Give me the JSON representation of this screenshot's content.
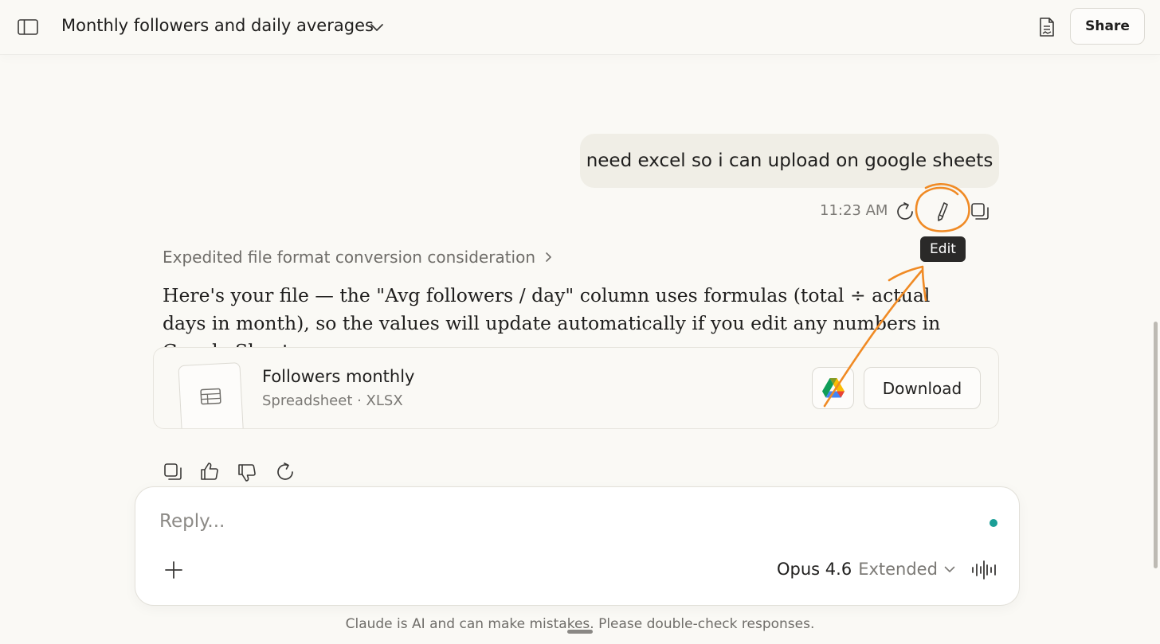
{
  "header": {
    "title": "Monthly followers and daily averages",
    "share_label": "Share"
  },
  "user_message": {
    "text": "need excel so i can upload on google sheets",
    "time": "11:23 AM",
    "tooltip": "Edit"
  },
  "assistant": {
    "thinking_label": "Expedited file format conversion consideration",
    "answer": "Here's your file — the \"Avg followers / day\" column uses formulas (total ÷ actual days in month), so the values will update automatically if you edit any numbers in Google Sheets.",
    "file": {
      "name": "Followers monthly",
      "meta": "Spreadsheet · XLSX",
      "download_label": "Download"
    }
  },
  "composer": {
    "placeholder": "Reply...",
    "model_name": "Opus 4.6",
    "model_mode": "Extended"
  },
  "disclaimer": "Claude is AI and can make mistakes. Please double-check responses.",
  "colors": {
    "background": "#faf9f5",
    "bubble": "#f0eee6",
    "annotation": "#f08a24",
    "status_dot": "#1a9e96"
  },
  "icons": [
    "sidebar-toggle-icon",
    "chevron-down-icon",
    "document-icon",
    "retry-icon",
    "pencil-icon",
    "copy-icon",
    "chevron-right-icon",
    "spreadsheet-icon",
    "google-drive-icon",
    "thumbs-up-icon",
    "thumbs-down-icon",
    "plus-icon",
    "voice-waveform-icon"
  ]
}
